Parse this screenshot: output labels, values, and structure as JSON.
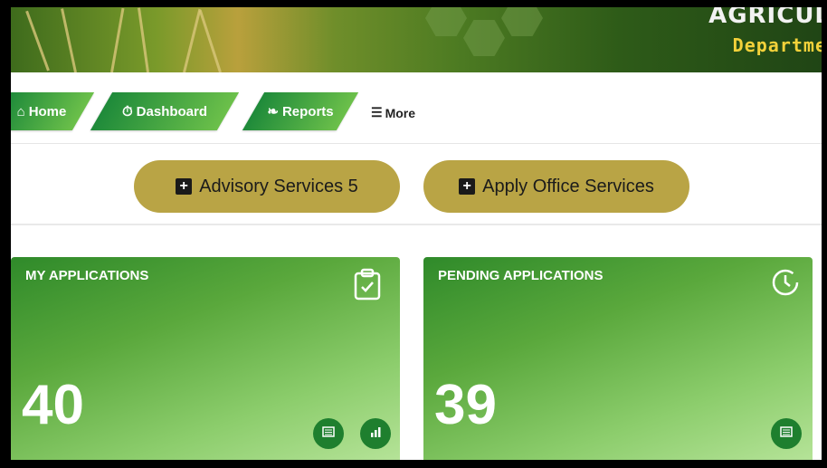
{
  "header": {
    "title_partial": "AGRICUL",
    "subtitle_partial": "Departme"
  },
  "nav": {
    "items": [
      {
        "label": "Home",
        "icon": "home-icon"
      },
      {
        "label": "Dashboard",
        "icon": "dashboard-icon"
      },
      {
        "label": "Reports",
        "icon": "reports-icon"
      }
    ],
    "more_label": "More"
  },
  "services": {
    "advisory_label": "Advisory Services 5",
    "apply_label": "Apply Office Services"
  },
  "cards": [
    {
      "title": "MY APPLICATIONS",
      "count": "40",
      "icon": "clipboard-check-icon"
    },
    {
      "title": "PENDING APPLICATIONS",
      "count": "39",
      "icon": "clock-icon"
    }
  ],
  "colors": {
    "nav_green": "#1e8a3a",
    "service_gold": "#b9a445",
    "card_green": "#2f8a2a",
    "round_button": "#1e7f2e"
  }
}
